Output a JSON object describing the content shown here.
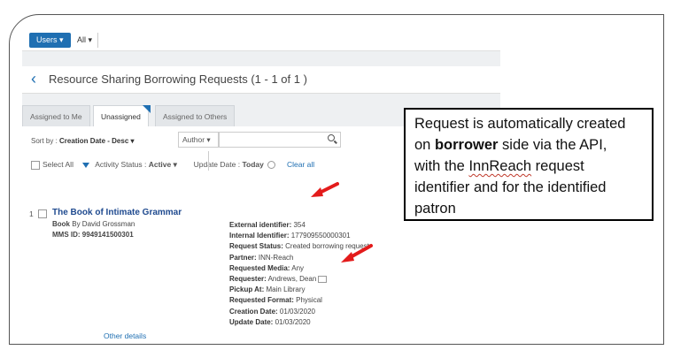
{
  "topbar": {
    "users_label": "Users ▾",
    "all_label": "All ▾"
  },
  "page": {
    "title": "Resource Sharing Borrowing Requests (1 - 1 of 1 )"
  },
  "tabs": [
    {
      "label": "Assigned to Me"
    },
    {
      "label": "Unassigned",
      "active": true
    },
    {
      "label": "Assigned to Others"
    }
  ],
  "sort": {
    "prefix": "Sort by :",
    "value": "Creation Date - Desc ▾",
    "author_label": "Author ▾"
  },
  "filters": {
    "select_all": "Select All",
    "activity_label": "Activity Status :",
    "activity_value": "Active ▾",
    "update_label": "Update Date :",
    "update_value": "Today",
    "clear_all": "Clear all"
  },
  "record": {
    "number": "1",
    "title": "The Book of Intimate Grammar",
    "type": "Book",
    "by": "By David Grossman",
    "mms_label": "MMS ID:",
    "mms_value": "9949141500301",
    "fields": [
      {
        "label": "External identifier:",
        "value": "354"
      },
      {
        "label": "Internal Identifier:",
        "value": "177909550000301"
      },
      {
        "label": "Request Status:",
        "value": "Created borrowing request"
      },
      {
        "label": "Partner:",
        "value": "INN-Reach"
      },
      {
        "label": "Requested Media:",
        "value": "Any"
      },
      {
        "label": "Requester:",
        "value": "Andrews, Dean"
      },
      {
        "label": "Pickup At:",
        "value": "Main Library"
      },
      {
        "label": "Requested Format:",
        "value": "Physical"
      },
      {
        "label": "Creation Date:",
        "value": "01/03/2020"
      },
      {
        "label": "Update Date:",
        "value": "01/03/2020"
      }
    ],
    "other_details": "Other details"
  },
  "callout": {
    "line1": "Request is automatically created",
    "line2_pre": "on ",
    "line2_bold": "borrower",
    "line2_post": " side via the API,",
    "line3_pre": "with the ",
    "line3_underlined": "InnReach",
    "line3_post": " request",
    "line4": "identifier and for the identified",
    "line5": "patron"
  },
  "colors": {
    "accent": "#1f6fb2",
    "arrow": "#e31b1b"
  }
}
